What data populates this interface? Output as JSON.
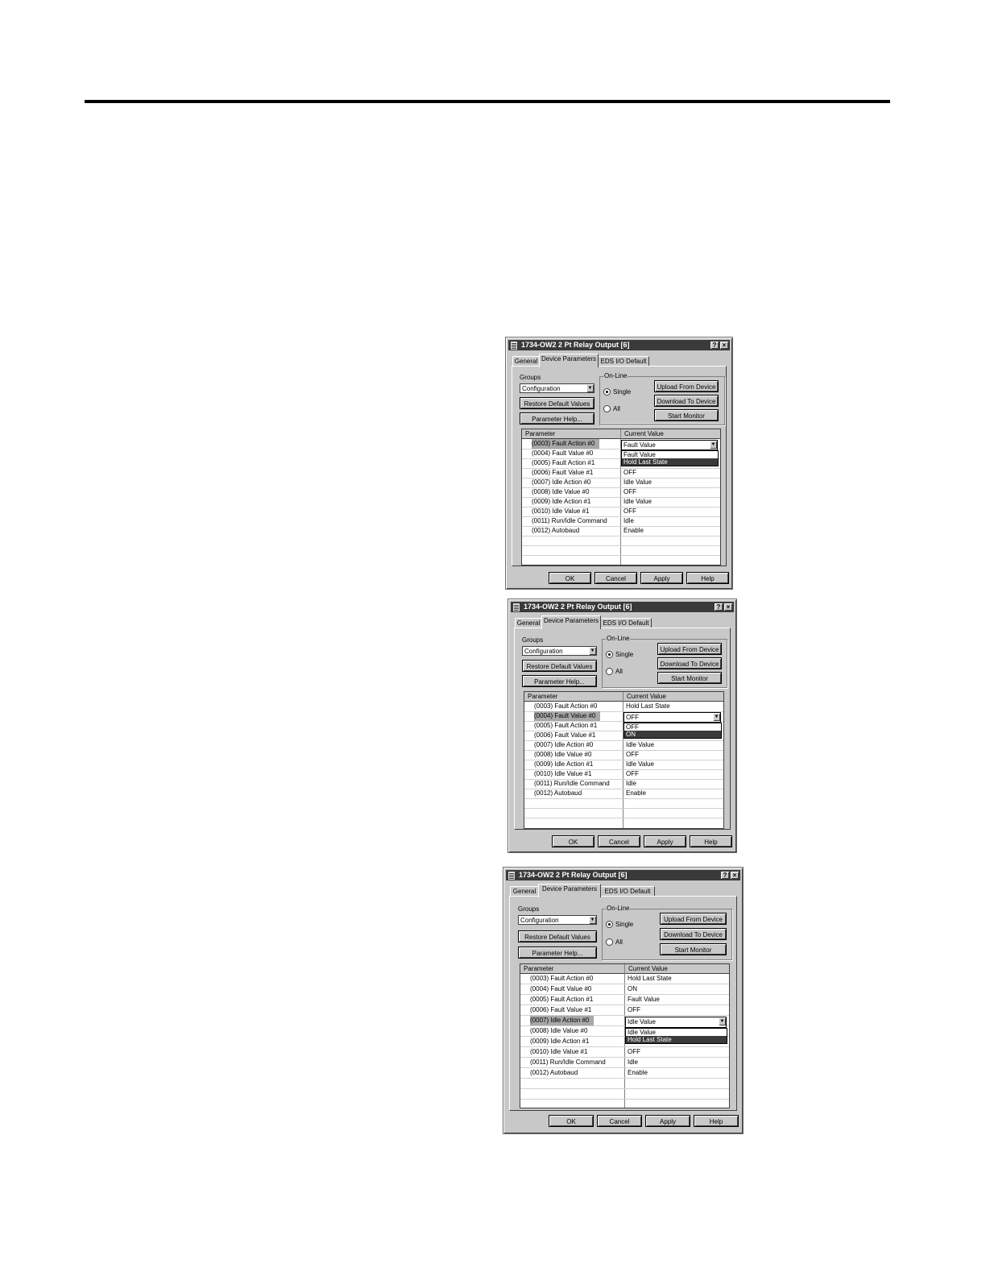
{
  "dialogs": [
    {
      "title": "1734-OW2 2 Pt Relay Output [6]",
      "tabs": [
        "General",
        "Device Parameters",
        "EDS I/O Default"
      ],
      "groups_label": "Groups",
      "groups_value": "Configuration",
      "restore_label": "Restore Default Values",
      "param_help_label": "Parameter Help...",
      "online_label": "On-Line",
      "single_label": "Single",
      "all_label": "All",
      "upload_label": "Upload From Device",
      "download_label": "Download To Device",
      "monitor_label": "Start Monitor",
      "col_param": "Parameter",
      "col_value": "Current Value",
      "rows": [
        {
          "p": "(0003) Fault Action #0",
          "v": "Fault Value"
        },
        {
          "p": "(0004) Fault Value #0",
          "v": ""
        },
        {
          "p": "(0005) Fault Action #1",
          "v": ""
        },
        {
          "p": "(0006) Fault Value #1",
          "v": "OFF"
        },
        {
          "p": "(0007) Idle Action #0",
          "v": "Idle Value"
        },
        {
          "p": "(0008) Idle Value #0",
          "v": "OFF"
        },
        {
          "p": "(0009) Idle Action #1",
          "v": "Idle Value"
        },
        {
          "p": "(0010) Idle Value #1",
          "v": "OFF"
        },
        {
          "p": "(0011) Run/Idle Command",
          "v": "Idle"
        },
        {
          "p": "(0012) Autobaud",
          "v": "Enable"
        }
      ],
      "dropdown_options": [
        "Fault Value",
        "Hold Last State"
      ],
      "ok_label": "OK",
      "cancel_label": "Cancel",
      "apply_label": "Apply",
      "help_label": "Help"
    },
    {
      "title": "1734-OW2 2 Pt Relay Output [6]",
      "tabs": [
        "General",
        "Device Parameters",
        "EDS I/O Default"
      ],
      "groups_label": "Groups",
      "groups_value": "Configuration",
      "restore_label": "Restore Default Values",
      "param_help_label": "Parameter Help...",
      "online_label": "On-Line",
      "single_label": "Single",
      "all_label": "All",
      "upload_label": "Upload From Device",
      "download_label": "Download To Device",
      "monitor_label": "Start Monitor",
      "col_param": "Parameter",
      "col_value": "Current Value",
      "rows": [
        {
          "p": "(0003) Fault Action #0",
          "v": "Hold Last State"
        },
        {
          "p": "(0004) Fault Value #0",
          "v": "OFF"
        },
        {
          "p": "(0005) Fault Action #1",
          "v": ""
        },
        {
          "p": "(0006) Fault Value #1",
          "v": ""
        },
        {
          "p": "(0007) Idle Action #0",
          "v": "Idle Value"
        },
        {
          "p": "(0008) Idle Value #0",
          "v": "OFF"
        },
        {
          "p": "(0009) Idle Action #1",
          "v": "Idle Value"
        },
        {
          "p": "(0010) Idle Value #1",
          "v": "OFF"
        },
        {
          "p": "(0011) Run/Idle Command",
          "v": "Idle"
        },
        {
          "p": "(0012) Autobaud",
          "v": "Enable"
        }
      ],
      "dropdown_options": [
        "OFF",
        "ON"
      ],
      "ok_label": "OK",
      "cancel_label": "Cancel",
      "apply_label": "Apply",
      "help_label": "Help"
    },
    {
      "title": "1734-OW2 2 Pt Relay Output [6]",
      "tabs": [
        "General",
        "Device Parameters",
        "EDS I/O Default"
      ],
      "groups_label": "Groups",
      "groups_value": "Configuration",
      "restore_label": "Restore Default Values",
      "param_help_label": "Parameter Help...",
      "online_label": "On-Line",
      "single_label": "Single",
      "all_label": "All",
      "upload_label": "Upload From Device",
      "download_label": "Download To Device",
      "monitor_label": "Start Monitor",
      "col_param": "Parameter",
      "col_value": "Current Value",
      "rows": [
        {
          "p": "(0003) Fault Action #0",
          "v": "Hold Last State"
        },
        {
          "p": "(0004) Fault Value #0",
          "v": "ON"
        },
        {
          "p": "(0005) Fault Action #1",
          "v": "Fault Value"
        },
        {
          "p": "(0006) Fault Value #1",
          "v": "OFF"
        },
        {
          "p": "(0007) Idle Action #0",
          "v": "Idle Value"
        },
        {
          "p": "(0008) Idle Value #0",
          "v": ""
        },
        {
          "p": "(0009) Idle Action #1",
          "v": ""
        },
        {
          "p": "(0010) Idle Value #1",
          "v": "OFF"
        },
        {
          "p": "(0011) Run/Idle Command",
          "v": "Idle"
        },
        {
          "p": "(0012) Autobaud",
          "v": "Enable"
        }
      ],
      "dropdown_options": [
        "Idle Value",
        "Hold Last State"
      ],
      "ok_label": "OK",
      "cancel_label": "Cancel",
      "apply_label": "Apply",
      "help_label": "Help"
    }
  ]
}
